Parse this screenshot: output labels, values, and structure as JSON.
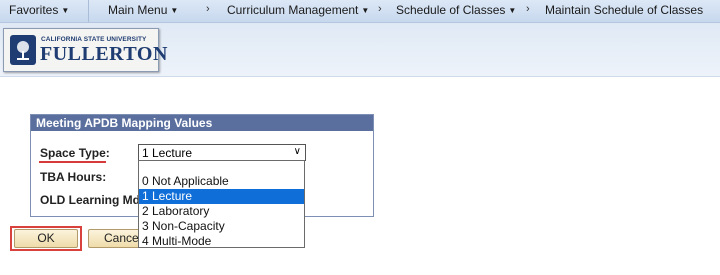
{
  "nav": {
    "favorites": "Favorites",
    "main_menu": "Main Menu",
    "curriculum": "Curriculum Management",
    "schedule": "Schedule of Classes",
    "maintain": "Maintain Schedule of Classes"
  },
  "logo": {
    "top_text": "CALIFORNIA STATE UNIVERSITY",
    "main_text": "FULLERTON"
  },
  "group": {
    "title": "Meeting APDB Mapping Values",
    "space_type_label": "Space Type:",
    "tba_hours_label": "TBA Hours:",
    "old_learning_label": "OLD Learning Md:",
    "space_type_value": "1 Lecture"
  },
  "dropdown": {
    "options": [
      "",
      "0 Not Applicable",
      "1 Lecture",
      "2 Laboratory",
      "3 Non-Capacity",
      "4 Multi-Mode"
    ],
    "selected_index": 2
  },
  "buttons": {
    "ok": "OK",
    "cancel": "Cancel"
  },
  "colors": {
    "header_bg": "#5b6f9f",
    "selected_option": "#0f6ed8",
    "highlight": "#d9413d"
  }
}
